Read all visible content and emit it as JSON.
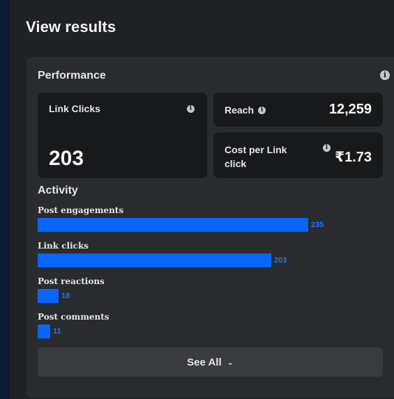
{
  "page": {
    "title": "View results"
  },
  "performance": {
    "title": "Performance",
    "info_icon": "info-icon",
    "metrics": {
      "link_clicks": {
        "label": "Link Clicks",
        "value": "203"
      },
      "reach": {
        "label": "Reach",
        "value": "12,259"
      },
      "cost_per_link_click": {
        "label": "Cost per Link click",
        "value": "₹1.73"
      }
    }
  },
  "activity": {
    "title": "Activity",
    "max_value": 235,
    "items": [
      {
        "label": "Post engagements",
        "value": 235
      },
      {
        "label": "Link clicks",
        "value": 203
      },
      {
        "label": "Post reactions",
        "value": 18
      },
      {
        "label": "Post comments",
        "value": 11
      }
    ]
  },
  "see_all": {
    "label": "See All",
    "icon": "chevron-down-icon"
  },
  "colors": {
    "bar": "#0866ff",
    "bar_value": "#2374ff",
    "card": "#2a2b2e",
    "metric_bg": "#18191b"
  }
}
